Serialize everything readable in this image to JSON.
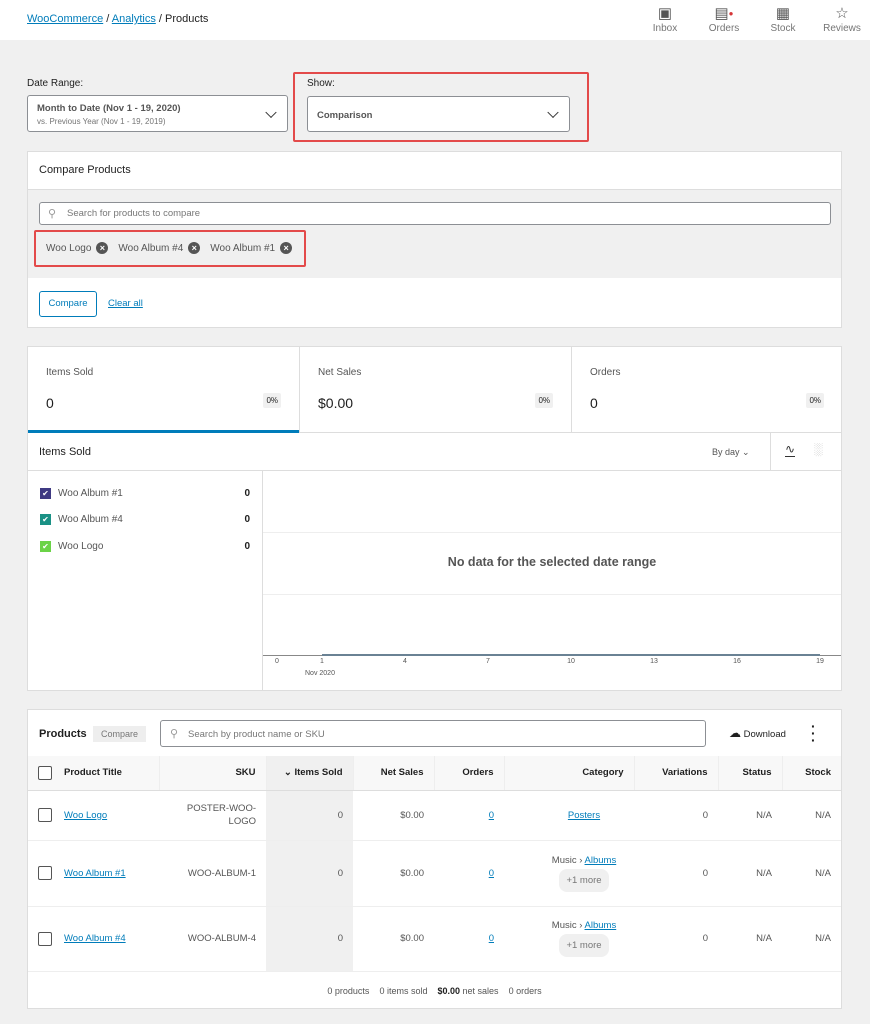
{
  "breadcrumb": {
    "root": "WooCommerce",
    "section": "Analytics",
    "current": "Products",
    "sep": "/"
  },
  "toolbar": [
    {
      "label": "Inbox",
      "icon": "inbox-icon"
    },
    {
      "label": "Orders",
      "icon": "orders-icon"
    },
    {
      "label": "Stock",
      "icon": "stock-icon"
    },
    {
      "label": "Reviews",
      "icon": "star-icon"
    }
  ],
  "filters": {
    "date_label": "Date Range:",
    "date_main": "Month to Date (Nov 1 - 19, 2020)",
    "date_compare": "vs. Previous Year (Nov 1 - 19, 2019)",
    "show_label": "Show:",
    "show_value": "Comparison"
  },
  "compare": {
    "title": "Compare Products",
    "search_placeholder": "Search for products to compare",
    "chips": [
      "Woo Logo",
      "Woo Album #4",
      "Woo Album #1"
    ],
    "compare_button": "Compare",
    "clear_all": "Clear all"
  },
  "summary": [
    {
      "title": "Items Sold",
      "value": "0",
      "delta": "0%"
    },
    {
      "title": "Net Sales",
      "value": "$0.00",
      "delta": "0%"
    },
    {
      "title": "Orders",
      "value": "0",
      "delta": "0%"
    }
  ],
  "chart": {
    "title": "Items Sold",
    "interval": "By day",
    "empty": "No data for the selected date range",
    "legend": [
      {
        "label": "Woo Album #1",
        "value": "0",
        "color": "#3f3a83"
      },
      {
        "label": "Woo Album #4",
        "value": "0",
        "color": "#1a9185"
      },
      {
        "label": "Woo Logo",
        "value": "0",
        "color": "#6bd347"
      }
    ],
    "ticks": [
      "0",
      "1",
      "4",
      "7",
      "10",
      "13",
      "16",
      "19"
    ],
    "month": "Nov 2020"
  },
  "table": {
    "title": "Products",
    "compare_label": "Compare",
    "search_placeholder": "Search by product name or SKU",
    "download": "Download",
    "columns": [
      "Product Title",
      "SKU",
      "Items Sold",
      "Net Sales",
      "Orders",
      "Category",
      "Variations",
      "Status",
      "Stock"
    ],
    "rows": [
      {
        "title": "Woo Logo",
        "sku": "POSTER-WOO-LOGO",
        "items": "0",
        "net": "$0.00",
        "orders": "0",
        "cat_parent": "",
        "cat": "Posters",
        "more": "",
        "variations": "0",
        "status": "N/A",
        "stock": "N/A"
      },
      {
        "title": "Woo Album #1",
        "sku": "WOO-ALBUM-1",
        "items": "0",
        "net": "$0.00",
        "orders": "0",
        "cat_parent": "Music ›",
        "cat": "Albums",
        "more": "+1 more",
        "variations": "0",
        "status": "N/A",
        "stock": "N/A"
      },
      {
        "title": "Woo Album #4",
        "sku": "WOO-ALBUM-4",
        "items": "0",
        "net": "$0.00",
        "orders": "0",
        "cat_parent": "Music ›",
        "cat": "Albums",
        "more": "+1 more",
        "variations": "0",
        "status": "N/A",
        "stock": "N/A"
      }
    ],
    "footer": {
      "products": "0 products",
      "items": "0 items sold",
      "net_value": "$0.00",
      "net_label": " net sales",
      "orders": "0 orders"
    }
  }
}
